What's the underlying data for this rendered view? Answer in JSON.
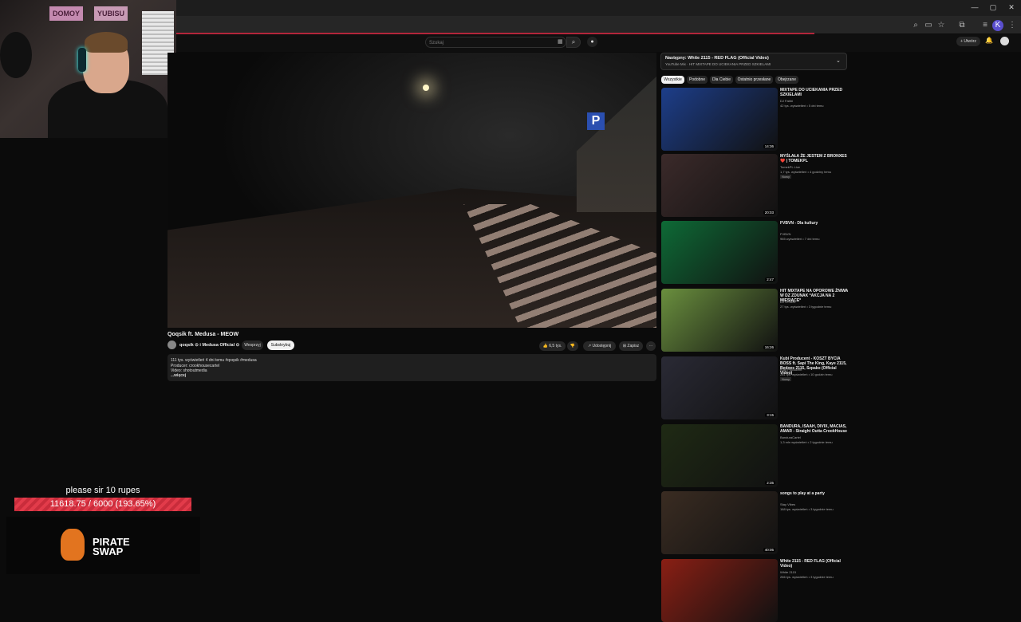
{
  "webcam": {
    "sign_left": "DOMOY",
    "sign_right": "YUBISU"
  },
  "youtube": {
    "search_placeholder": "Szukaj",
    "create_label": "+ Utwórz"
  },
  "video": {
    "title": "Qoqsik ft. Medusa - MEOW",
    "channel": "qoqsik ⊙ i Medusa Official ⊙",
    "support_label": "Wesprzyj",
    "subscribe_label": "Subskrybuj",
    "likes": "6,5 tys.",
    "share_label": "Udostępnij",
    "save_label": "Zapisz",
    "description": [
      "111 tys. wyświetleń  4 dni temu  #qoqsik #medusa",
      "Producer: crookhousecartel",
      "Video: shotoutmedia",
      "...więcej"
    ]
  },
  "sidebar": {
    "up_next_title": "Następny: White 2115 - RED FLAG (Official Video)",
    "up_next_sub": "YouTube Mix · HIT MIXTAPE DO UCIEKANIA PRZED SZKIELAMI",
    "chips": [
      "Wszystkie",
      "Podobne",
      "Dla Ciebie",
      "Ostatnio przesłane",
      "Obejrzane"
    ],
    "videos": [
      {
        "title": "MIXTAPE DO UCIEKANIA PRZED SZKIELAMI",
        "channel": "DJ Fabbi",
        "meta": "42 tys. wyświetleń • 5 dni temu",
        "duration": "14:36",
        "color": "#1d3e8a"
      },
      {
        "title": "MYŚLAŁA ŻE JESTEM Z BRONXES ❤️ | TOMEKPL",
        "channel": "TomekPL Live",
        "meta": "1,7 tys. wyświetleń • 4 godziny temu",
        "badge": "Nowy",
        "duration": "20:03",
        "color": "#3b2a2a"
      },
      {
        "title": "FVBVN - Dla kultury",
        "channel": "FVBVN",
        "meta": "965 wyświetleń • 7 dni temu",
        "duration": "2:47",
        "color": "#0e6a36"
      },
      {
        "title": "HIT MIXTAPE NA OPOROWE ŻNIWA W DZ ZDUNAK *AKCJA NA 2 MIESIĄCE*",
        "channel": "DJ SYNEK",
        "meta": "27 tys. wyświetleń • 3 tygodnie temu",
        "duration": "16:26",
        "color": "#6a8f3e"
      },
      {
        "title": "Kubi Producent - KOSZT BYCIA BOSS ft. Sapi The King, Kaye 2115, Bedoes 2115, Szpako (Official Video)",
        "channel": "Kubi Producent",
        "meta": "281 tys. wyświetleń • 10 godzin temu",
        "badge": "Nowy",
        "duration": "3:15",
        "color": "#2a2a35"
      },
      {
        "title": "BANDURA, ISAAH, DIVIX, MACIAS, AMAR - Straight Outta CrookHouse",
        "channel": "BanduraCartel",
        "meta": "1,3 mln wyświetleń • 2 tygodnie temu",
        "duration": "2:35",
        "color": "#1f2a14"
      },
      {
        "title": "songs to play at a party",
        "channel": "Stay Vibes",
        "meta": "168 tys. wyświetleń • 3 tygodnie temu",
        "duration": "40:05",
        "color": "#3a2c22"
      },
      {
        "title": "White 2115 - RED FLAG (Official Video)",
        "channel": "White 2115",
        "meta": "266 tys. wyświetleń • 3 tygodnie temu",
        "duration": "",
        "color": "#8a1f14"
      }
    ]
  },
  "overlay": {
    "goal_text": "please sir 10 rupes",
    "goal_progress": "11618.75 / 6000 (193.65%)",
    "goal_fraction": 1.9365,
    "sponsor_line1": "PIRATE",
    "sponsor_line2": "SWAP"
  }
}
